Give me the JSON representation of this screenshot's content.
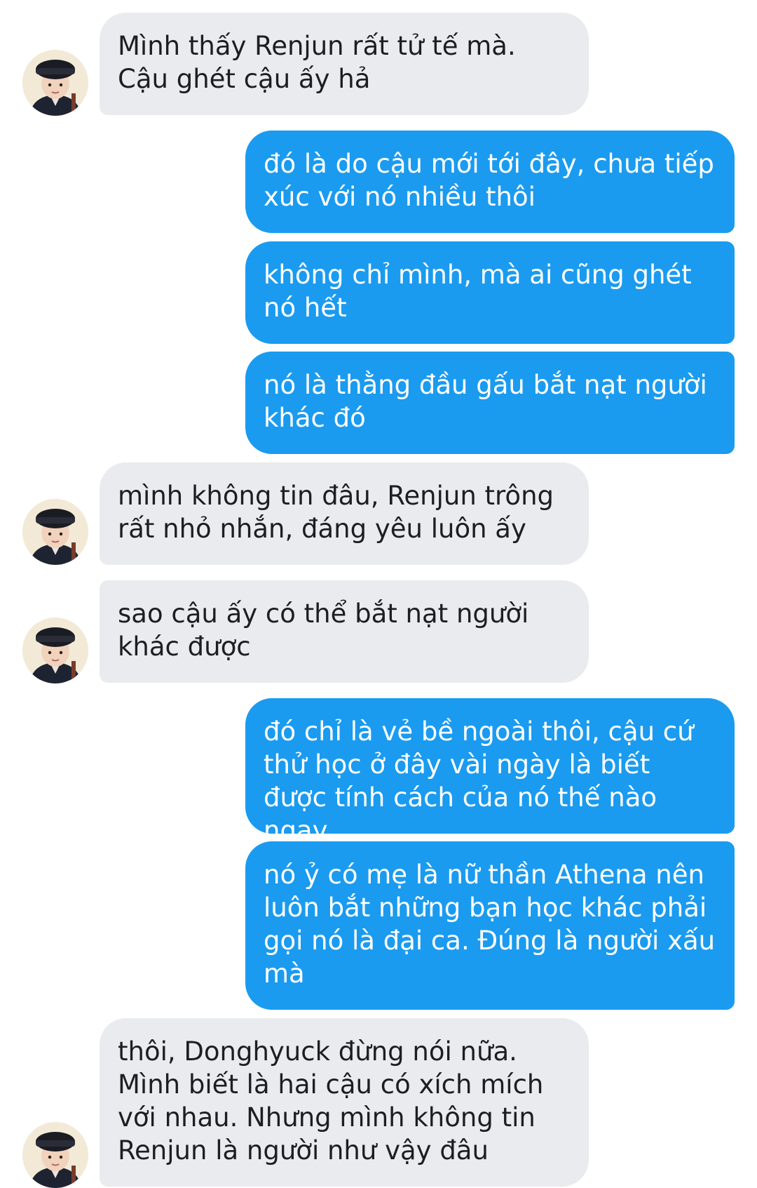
{
  "conversation": {
    "messages": [
      {
        "sender": "other",
        "text": "Mình thấy Renjun rất tử tế mà. Cậu ghét cậu ấy hả"
      },
      {
        "sender": "me",
        "text": "đó là do cậu mới tới đây, chưa tiếp xúc với nó nhiều thôi"
      },
      {
        "sender": "me",
        "text": "không chỉ mình, mà ai cũng ghét nó hết"
      },
      {
        "sender": "me",
        "text": "nó là thằng đầu gấu bắt nạt người khác đó"
      },
      {
        "sender": "other",
        "text": "mình không tin đâu, Renjun trông rất nhỏ nhắn, đáng yêu luôn ấy"
      },
      {
        "sender": "other",
        "text": "sao cậu ấy có thể bắt nạt người khác được"
      },
      {
        "sender": "me",
        "text": "đó chỉ là vẻ bề ngoài thôi, cậu cứ thử học ở đây vài ngày là biết được tính cách của nó thế nào ngay"
      },
      {
        "sender": "me",
        "text": "nó ỷ có mẹ là nữ thần Athena nên luôn bắt những bạn học khác phải gọi nó là đại ca. Đúng là người xấu mà"
      },
      {
        "sender": "other",
        "text": "thôi, Donghyuck đừng nói nữa. Mình biết là hai cậu có xích mích với nhau. Nhưng mình không tin Renjun là người như vậy đâu"
      }
    ]
  },
  "colors": {
    "incoming_bubble": "#e9ebee",
    "outgoing_bubble": "#1a9bf0",
    "incoming_text": "#1c1e21",
    "outgoing_text": "#ffffff"
  },
  "icons": {
    "avatar": "child-in-black-hat-avatar"
  }
}
